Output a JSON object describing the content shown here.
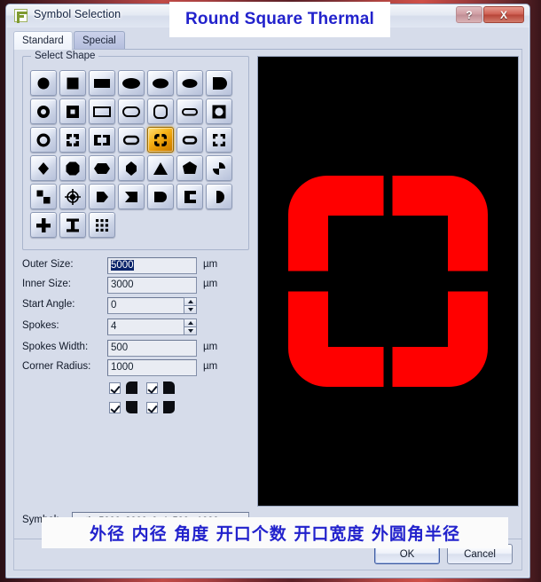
{
  "window": {
    "title": "Symbol Selection",
    "icon": "symbol-app-icon",
    "help_label": "?",
    "close_label": "X"
  },
  "tabs": [
    {
      "label": "Standard",
      "active": true
    },
    {
      "label": "Special",
      "active": false
    }
  ],
  "groupbox": {
    "title": "Select Shape",
    "shapes": [
      {
        "name": "circle",
        "row": 1
      },
      {
        "name": "square",
        "row": 1
      },
      {
        "name": "rectangle",
        "row": 1
      },
      {
        "name": "oval-wide",
        "row": 1
      },
      {
        "name": "oval",
        "row": 1
      },
      {
        "name": "ellipse",
        "row": 1
      },
      {
        "name": "d-shape",
        "row": 1
      },
      {
        "name": "donut",
        "row": 2
      },
      {
        "name": "square-ring",
        "row": 2
      },
      {
        "name": "rectangle-ring",
        "row": 2
      },
      {
        "name": "oblong-ring",
        "row": 2
      },
      {
        "name": "rounded-square-ring",
        "row": 2
      },
      {
        "name": "oval-ring",
        "row": 2
      },
      {
        "name": "square-donut",
        "row": 2
      },
      {
        "name": "round-thermal",
        "row": 3
      },
      {
        "name": "square-thermal",
        "row": 3
      },
      {
        "name": "rect-thermal",
        "row": 3
      },
      {
        "name": "oblong-thermal",
        "row": 3
      },
      {
        "name": "round-square-thermal",
        "row": 3,
        "selected": true
      },
      {
        "name": "oval-thermal",
        "row": 3
      },
      {
        "name": "square-thermal-open",
        "row": 3
      },
      {
        "name": "diamond",
        "row": 4
      },
      {
        "name": "octagon",
        "row": 4
      },
      {
        "name": "hexagon-h",
        "row": 4
      },
      {
        "name": "hexagon-v",
        "row": 4
      },
      {
        "name": "triangle",
        "row": 4
      },
      {
        "name": "heptagon",
        "row": 4
      },
      {
        "name": "pie-quarter",
        "row": 4
      },
      {
        "name": "offset-squares",
        "row": 5
      },
      {
        "name": "crosshair-target",
        "row": 5
      },
      {
        "name": "home-plate-right",
        "row": 5
      },
      {
        "name": "chevron-left",
        "row": 5
      },
      {
        "name": "bullet-right",
        "row": 5
      },
      {
        "name": "c-shape",
        "row": 5
      },
      {
        "name": "half-moon",
        "row": 5
      },
      {
        "name": "cross",
        "row": 6
      },
      {
        "name": "i-beam",
        "row": 6
      },
      {
        "name": "grid-array",
        "row": 6
      }
    ]
  },
  "fields": [
    {
      "name": "outer-size",
      "label": "Outer Size:",
      "value": "5000",
      "unit": "µm",
      "type": "text",
      "selected": true
    },
    {
      "name": "inner-size",
      "label": "Inner Size:",
      "value": "3000",
      "unit": "µm",
      "type": "text",
      "selected": false
    },
    {
      "name": "start-angle",
      "label": "Start Angle:",
      "value": "0",
      "unit": "",
      "type": "spin",
      "selected": false
    },
    {
      "name": "spokes",
      "label": "Spokes:",
      "value": "4",
      "unit": "",
      "type": "spin",
      "selected": false
    },
    {
      "name": "spokes-width",
      "label": "Spokes Width:",
      "value": "500",
      "unit": "µm",
      "type": "text",
      "selected": false
    },
    {
      "name": "corner-radius",
      "label": "Corner Radius:",
      "value": "1000",
      "unit": "µm",
      "type": "text",
      "selected": false
    }
  ],
  "corners": [
    {
      "name": "corner-top-left",
      "checked": true,
      "icon": "corner-round-top-left"
    },
    {
      "name": "corner-top-right",
      "checked": true,
      "icon": "corner-round-top-right"
    },
    {
      "name": "corner-bottom-left",
      "checked": true,
      "icon": "corner-round-bottom-left"
    },
    {
      "name": "corner-bottom-right",
      "checked": true,
      "icon": "corner-round-bottom-right"
    }
  ],
  "symbol": {
    "label": "Symbol:",
    "value": "s_ths5000x3000x0x4x500xr1000"
  },
  "footer": {
    "ok": "OK",
    "cancel": "Cancel"
  },
  "annotations": {
    "top_title": "Round Square Thermal",
    "bottom_legend": "外径  内径  角度 开口个数 开口宽度  外圆角半径"
  },
  "preview": {
    "name": "shape-preview",
    "background": "#000000",
    "shape_color": "#ff0000",
    "shape": "round-square-thermal",
    "outer_size": 5000,
    "inner_size": 3000,
    "start_angle": 0,
    "spokes": 4,
    "spokes_width": 500,
    "corner_radius": 1000
  }
}
